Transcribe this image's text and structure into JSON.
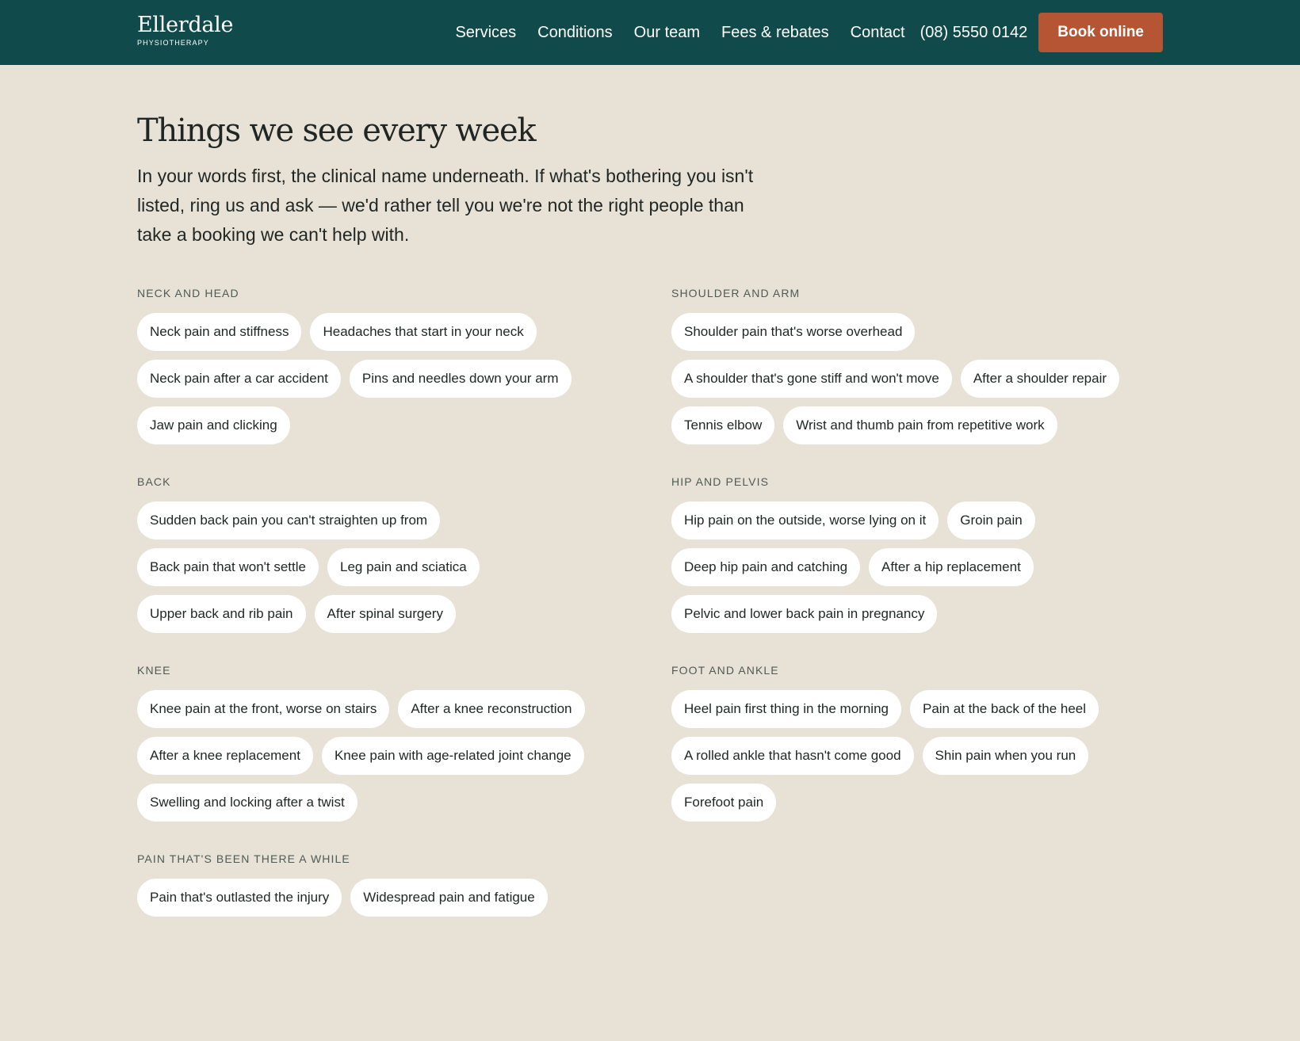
{
  "brand": {
    "name": "Ellerdale",
    "subtitle": "PHYSIOTHERAPY"
  },
  "nav": {
    "links": [
      "Services",
      "Conditions",
      "Our team",
      "Fees & rebates",
      "Contact"
    ],
    "phone": "(08) 5550 0142",
    "book_label": "Book online"
  },
  "page": {
    "title": "Things we see every week",
    "intro": "In your words first, the clinical name underneath. If what's bothering you isn't listed, ring us and ask — we'd rather tell you we're not the right people than take a booking we can't help with."
  },
  "groups": [
    {
      "heading": "NECK AND HEAD",
      "items": [
        "Neck pain and stiffness",
        "Headaches that start in your neck",
        "Neck pain after a car accident",
        "Pins and needles down your arm",
        "Jaw pain and clicking"
      ]
    },
    {
      "heading": "SHOULDER AND ARM",
      "items": [
        "Shoulder pain that's worse overhead",
        "A shoulder that's gone stiff and won't move",
        "After a shoulder repair",
        "Tennis elbow",
        "Wrist and thumb pain from repetitive work"
      ]
    },
    {
      "heading": "BACK",
      "items": [
        "Sudden back pain you can't straighten up from",
        "Back pain that won't settle",
        "Leg pain and sciatica",
        "Upper back and rib pain",
        "After spinal surgery"
      ]
    },
    {
      "heading": "HIP AND PELVIS",
      "items": [
        "Hip pain on the outside, worse lying on it",
        "Groin pain",
        "Deep hip pain and catching",
        "After a hip replacement",
        "Pelvic and lower back pain in pregnancy"
      ]
    },
    {
      "heading": "KNEE",
      "items": [
        "Knee pain at the front, worse on stairs",
        "After a knee reconstruction",
        "After a knee replacement",
        "Knee pain with age-related joint change",
        "Swelling and locking after a twist"
      ]
    },
    {
      "heading": "FOOT AND ANKLE",
      "items": [
        "Heel pain first thing in the morning",
        "Pain at the back of the heel",
        "A rolled ankle that hasn't come good",
        "Shin pain when you run",
        "Forefoot pain"
      ]
    },
    {
      "heading": "PAIN THAT'S BEEN THERE A WHILE",
      "items": [
        "Pain that's outlasted the injury",
        "Widespread pain and fatigue"
      ]
    }
  ]
}
